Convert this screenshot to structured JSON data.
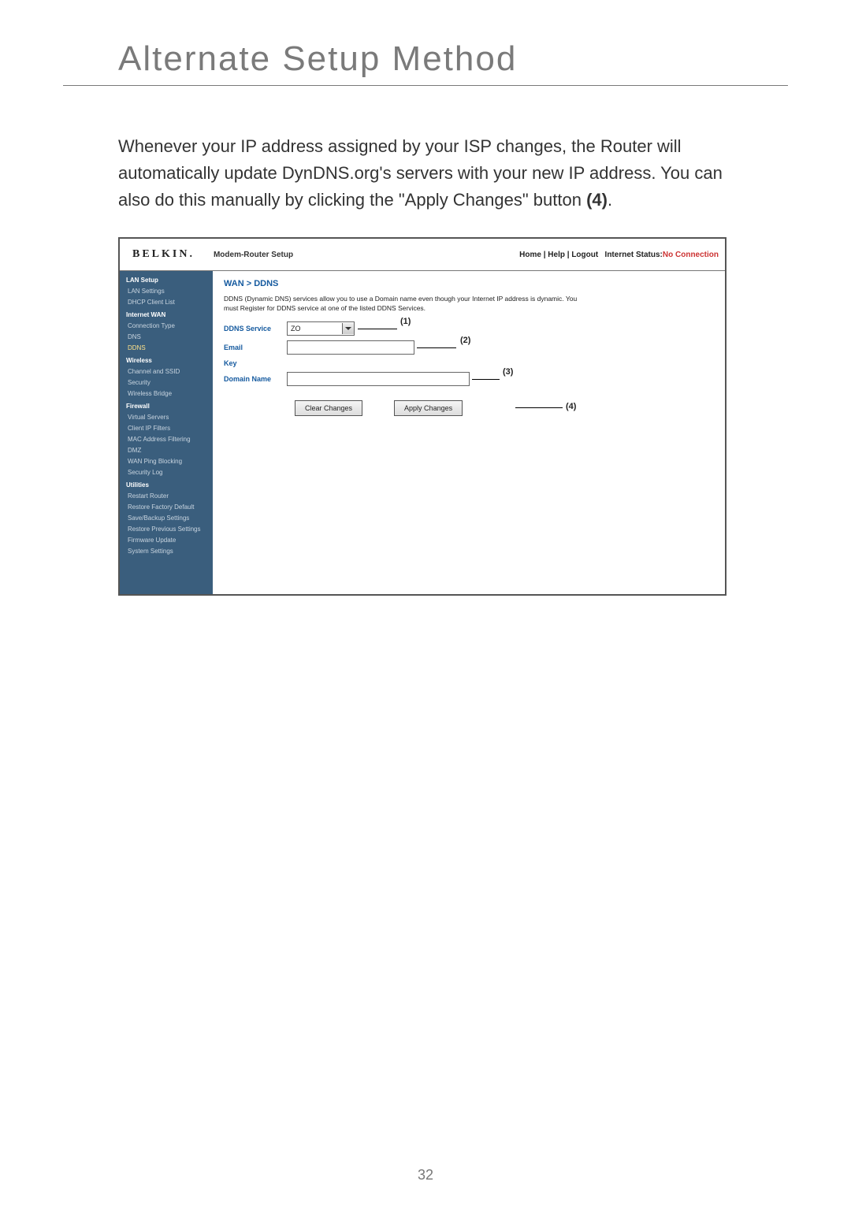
{
  "page": {
    "title": "Alternate Setup Method",
    "paragraph_a": "Whenever your IP address assigned by your ISP changes, the Router will automatically update DynDNS.org's servers with your new IP address. You can also do this manually by clicking the \"Apply Changes\" button ",
    "paragraph_ref": "(4)",
    "paragraph_b": ".",
    "number": "32"
  },
  "screenshot": {
    "logo": "BELKIN.",
    "app_title": "Modem-Router Setup",
    "toplinks": {
      "a": "Home",
      "b": "Help",
      "c": "Logout",
      "status_label": "Internet Status:",
      "status_value": "No Connection"
    },
    "sidebar": {
      "groups": [
        {
          "header": "LAN Setup",
          "items": [
            "LAN Settings",
            "DHCP Client List"
          ]
        },
        {
          "header": "Internet WAN",
          "items": [
            "Connection Type",
            "DNS",
            "DDNS"
          ],
          "highlight": "DDNS"
        },
        {
          "header": "Wireless",
          "items": [
            "Channel and SSID",
            "Security",
            "Wireless Bridge"
          ]
        },
        {
          "header": "Firewall",
          "items": [
            "Virtual Servers",
            "Client IP Filters",
            "MAC Address Filtering",
            "DMZ",
            "WAN Ping Blocking",
            "Security Log"
          ]
        },
        {
          "header": "Utilities",
          "items": [
            "Restart Router",
            "Restore Factory Default",
            "Save/Backup Settings",
            "Restore Previous Settings",
            "Firmware Update",
            "System Settings"
          ]
        }
      ]
    },
    "content": {
      "breadcrumb": "WAN > DDNS",
      "description": "DDNS (Dynamic DNS) services allow you to use a Domain name even though your Internet IP address is dynamic. You must Register for DDNS service at one of the listed DDNS Services.",
      "fields": {
        "ddns_service_label": "DDNS Service",
        "ddns_service_value": "ZO",
        "email_label": "Email",
        "key_label": "Key",
        "domain_label": "Domain Name"
      },
      "buttons": {
        "clear": "Clear Changes",
        "apply": "Apply Changes"
      },
      "callouts": {
        "c1": "(1)",
        "c2": "(2)",
        "c3": "(3)",
        "c4": "(4)"
      }
    }
  }
}
